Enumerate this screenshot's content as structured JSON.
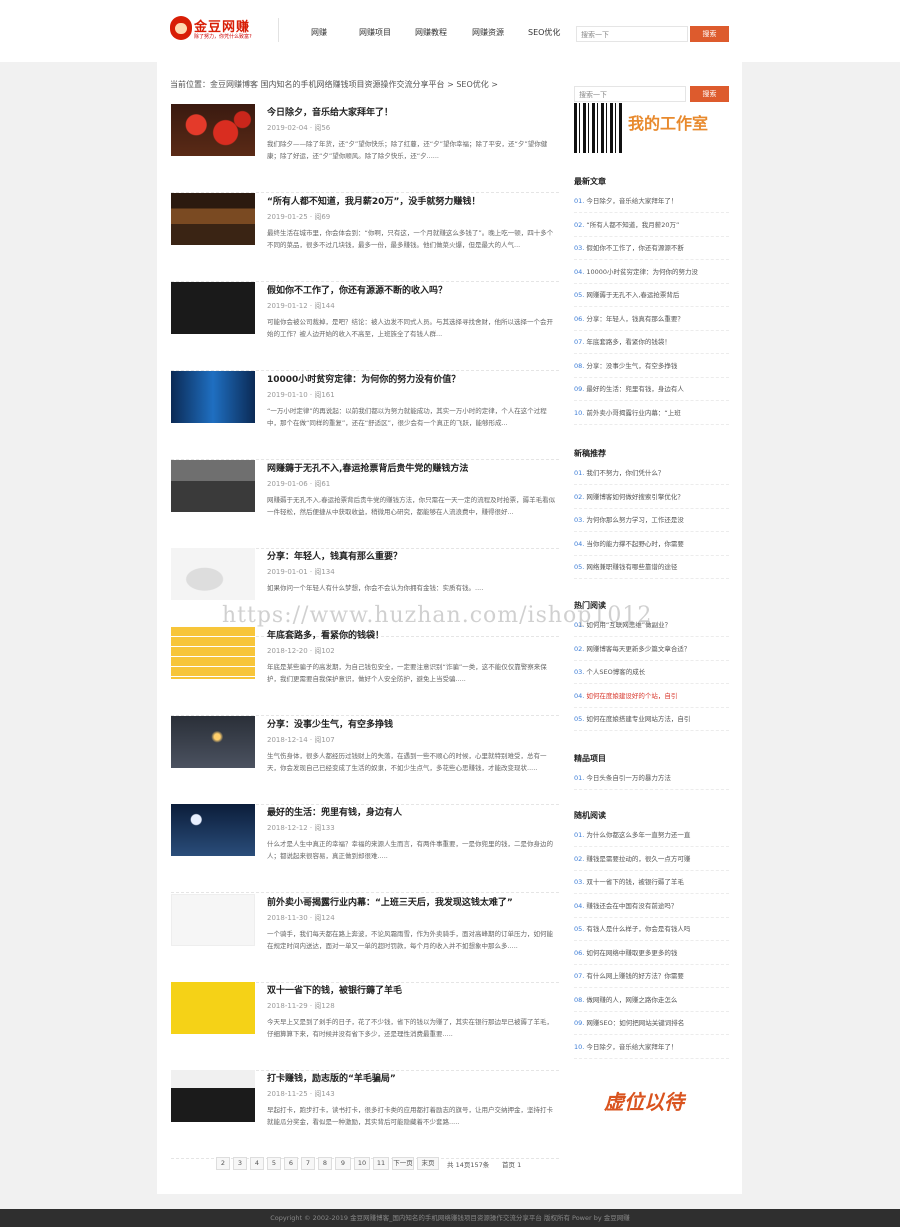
{
  "header": {
    "logo_title": "金豆网赚",
    "logo_slogan": "除了努力，你凭什么致富?",
    "nav": [
      "网赚",
      "网赚项目",
      "网赚教程",
      "网赚资源",
      "SEO优化"
    ],
    "search_placeholder": "搜索一下",
    "search_button": "搜索"
  },
  "breadcrumb": "当前位置：金豆网赚博客 国内知名的手机网络赚钱项目资源操作交流分享平台 > SEO优化 >",
  "articles": [
    {
      "title": "今日除夕，音乐给大家拜年了！",
      "meta": "2019-02-04 · 阅56",
      "summary": "我们除夕——除了年货，还“夕”望你快乐；除了红蔓，还“夕”望你幸福；除了平安，还“夕”望你健康；除了好运，还“夕”望你顺风。除了除夕快乐，还“夕......"
    },
    {
      "title": "“所有人都不知道，我月薪20万”，没手就努力赚钱！",
      "meta": "2019-01-25 · 阅69",
      "summary": "最终生活在城市里，你会体会到：“你啊，只有这，一个月就赚这么多钱了”。晚上吃一顿，四十多个不同的菜品，很多不过几块钱，最多一份，最多赚钱。他们做菜火爆，但是最大的人气..."
    },
    {
      "title": "假如你不工作了，你还有源源不断的收入吗？",
      "meta": "2019-01-12 · 阅144",
      "summary": "可能你会被公司裁掉，是吧？结论：被人边发不同式人员。与其选择寻找舍财，他所以选择一个会开始的工作？被人边开始的收入不高至，上班族全了有钱人群..."
    },
    {
      "title": "10000小时贫穷定律：为何你的努力没有价值？",
      "meta": "2019-01-10 · 阅161",
      "summary": "“一万小时定律”的再说起：以前我们都以为努力就能成功，其实一万小时的定律，个人在这个过程中，那个在做“同样的重复”，还在“舒适区”，很少会有一个真正的飞跃，能够形成..."
    },
    {
      "title": "网赚薅于无孔不入,春运抢票背后贵牛党的赚钱方法",
      "meta": "2019-01-06 · 阅61",
      "summary": "网赚薅于无孔不入,春运抢票背后贵牛党的赚钱方法，你只需在一天一定的流程及时抢票，薅羊毛看似一件轻松，然后便捷从中获取收益，稍微用心研究，都能够在人流浪费中，赚得很好..."
    },
    {
      "title": "分享：年轻人，钱真有那么重要？",
      "meta": "2019-01-01 · 阅134",
      "summary": "如果你问一个年轻人有什么梦想，你会不会认为你拥有金钱：实质有钱。...."
    },
    {
      "title": "年底套路多，看紧你的钱袋！",
      "meta": "2018-12-20 · 阅102",
      "summary": "年底是某些骗子的高发期，为自己钱包安全，一定要注意识别“诈骗”一类，这不能仅仅靠警察来保护，我们更需要自我保护意识，做好个人安全防护，避免上当受骗....."
    },
    {
      "title": "分享：没事少生气，有空多挣钱",
      "meta": "2018-12-14 · 阅107",
      "summary": "生气伤身体，很多人都经历过钱财上的失落，在遇到一些不顺心的时候，心里就特别难受，总有一天，你会发现自己已经变成了生活的奴隶，不如少生点气，多花些心思赚钱，才能改变现状....."
    },
    {
      "title": "最好的生活：兜里有钱，身边有人",
      "meta": "2018-12-12 · 阅133",
      "summary": "什么才是人生中真正的幸福？幸福的来源人生而言，有两件事重要，一是你兜里的钱，二是你身边的人；都说起来很容易，真正做到却很难....."
    },
    {
      "title": "前外卖小哥揭露行业内幕：“上班三天后，我发现这钱太难了”",
      "meta": "2018-11-30 · 阅124",
      "summary": "一个骑手，我们每天都在路上奔波，不论风霜雨雪，作为外卖骑手，面对高峰期的订单压力，如何能在规定时间内送达，面对一单又一单的超时罚款，每个月的收入并不如想象中那么多....."
    },
    {
      "title": "双十一省下的钱，被银行薅了羊毛",
      "meta": "2018-11-29 · 阅128",
      "summary": "今天早上又是到了剁手的日子，花了不少钱，省下的钱以为赚了，其实在银行那边早已被薅了羊毛，仔细算算下来，有时候并没有省下多少，还是理性消费最重要....."
    },
    {
      "title": "打卡赚钱，励志版的“羊毛骗局”",
      "meta": "2018-11-25 · 阅143",
      "summary": "早起打卡，跑步打卡，读书打卡，很多打卡类的应用都打着励志的旗号，让用户交纳押金，坚持打卡就能瓜分奖金，看似是一种激励，其实背后可能隐藏着不少套路....."
    }
  ],
  "sidebar": {
    "search_placeholder": "搜索一下",
    "search_button": "搜索",
    "workroom_text": "我的工作室",
    "sections": [
      {
        "heading": "最新文章",
        "items": [
          "01. 今日除夕，音乐给大家拜年了！",
          "02. “所有人都不知道，我月薪20万”",
          "03. 假如你不工作了，你还有源源不断",
          "04. 10000小时贫穷定律：为何你的努力没",
          "05. 网赚薅于无孔不入,春运抢票背后",
          "06. 分享：年轻人，钱真有那么重要？",
          "07. 年底套路多，看紧你的钱袋！",
          "08. 分享：没事少生气，有空多挣钱",
          "09. 最好的生活：兜里有钱，身边有人",
          "10. 前外卖小哥揭露行业内幕：“上班"
        ]
      },
      {
        "heading": "新稿推荐",
        "items": [
          "01. 我们不努力，你们凭什么？",
          "02. 网赚博客如何做好搜索引擎优化？",
          "03. 为何你那么努力学习，工作还是没",
          "04. 当你的能力撑不起野心时，你需要",
          "05. 网络兼职赚钱有哪些靠谱的途径"
        ]
      },
      {
        "heading": "热门阅读",
        "items": [
          "01. 如何用“互联网思维”做副业？",
          "02. 网赚博客每天更新多少篇文章合适？",
          "03. 个人SEO博客的成长",
          "04. 如何在度娘建设好的个站，自引",
          "05. 如何在度娘搭建专业网站方法，自引"
        ],
        "hot_index": 3
      },
      {
        "heading": "精品项目",
        "items": [
          "01. 今日头条自引一万的暴力方法"
        ]
      },
      {
        "heading": "随机阅读",
        "items": [
          "01. 为什么你都这么多年一直努力还一直",
          "02. 赚钱是需要拉动的，很久一点方可赚",
          "03. 双十一省下的钱，被银行薅了羊毛",
          "04. 赚钱还会在中国有没有前途吗？",
          "05. 有钱人是什么样子，你会是有钱人吗",
          "06. 如何在网络中赚取更多更多的钱",
          "07. 有什么网上赚钱的好方法？你需要",
          "08. 做网赚的人，网赚之路你走怎么",
          "09. 网赚SEO：如何把网站关键词排名",
          "10. 今日除夕，音乐给大家拜年了！"
        ]
      }
    ],
    "ad_text": "虚位以待"
  },
  "pager": {
    "pages": [
      "2",
      "3",
      "4",
      "5",
      "6",
      "7",
      "8",
      "9",
      "10",
      "11",
      "下一页",
      "末页"
    ],
    "info": "共 14页157条",
    "current": "首页 1"
  },
  "watermark": "https://www.huzhan.com/ishop1012",
  "footer": "Copyright © 2002-2019 金豆网赚博客_国内知名的手机网络赚钱项目资源操作交流分享平台 版权所有 Power by 金豆网赚",
  "colors": {
    "accent": "#dd5b2d",
    "link_number": "#3a7bd5",
    "hot": "#d8372c"
  }
}
